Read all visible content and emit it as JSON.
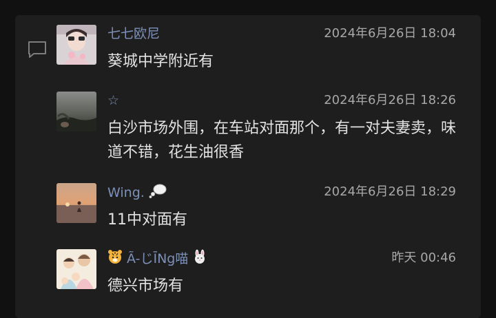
{
  "icons": {
    "comment": "comment-icon"
  },
  "comments": [
    {
      "name": "七七欧尼",
      "time": "2024年6月26日 18:04",
      "text": "葵城中学附近有"
    },
    {
      "name": "☆",
      "time": "2024年6月26日 18:26",
      "text": "白沙市场外围，在车站对面那个，有一对夫妻卖，味道不错，花生油很香"
    },
    {
      "name": "Wing.",
      "time": "2024年6月26日 18:29",
      "text": "11中对面有"
    },
    {
      "name": "Ã-じĪNg喵",
      "time": "昨天 00:46",
      "text": "德兴市场有"
    }
  ]
}
